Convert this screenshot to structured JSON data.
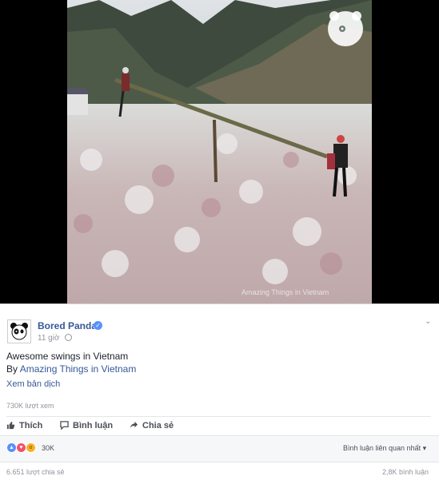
{
  "video": {
    "watermark": "Amazing Things in Vietnam"
  },
  "post": {
    "page_name": "Bored Panda",
    "time": "11 giờ",
    "line1": "Awesome swings in Vietnam",
    "by_prefix": "By ",
    "by_link": "Amazing Things in Vietnam",
    "translate": "Xem bản dịch",
    "views": "730K lượt xem"
  },
  "actions": {
    "like": "Thích",
    "comment": "Bình luận",
    "share": "Chia sẻ"
  },
  "reactions": {
    "count": "30K",
    "sort_label": "Bình luận liên quan nhất ▾"
  },
  "footer": {
    "shares": "6.651 lượt chia sẻ",
    "comments": "2,8K bình luận"
  },
  "icons": [
    "panda-logo-icon",
    "verified-icon",
    "globe-icon",
    "chevron-down-icon",
    "like-icon",
    "comment-icon",
    "share-icon"
  ],
  "colors": {
    "link": "#365899",
    "verified": "#5890ff",
    "like": "#5890ff",
    "love": "#f25268",
    "wow": "#f7b125"
  }
}
